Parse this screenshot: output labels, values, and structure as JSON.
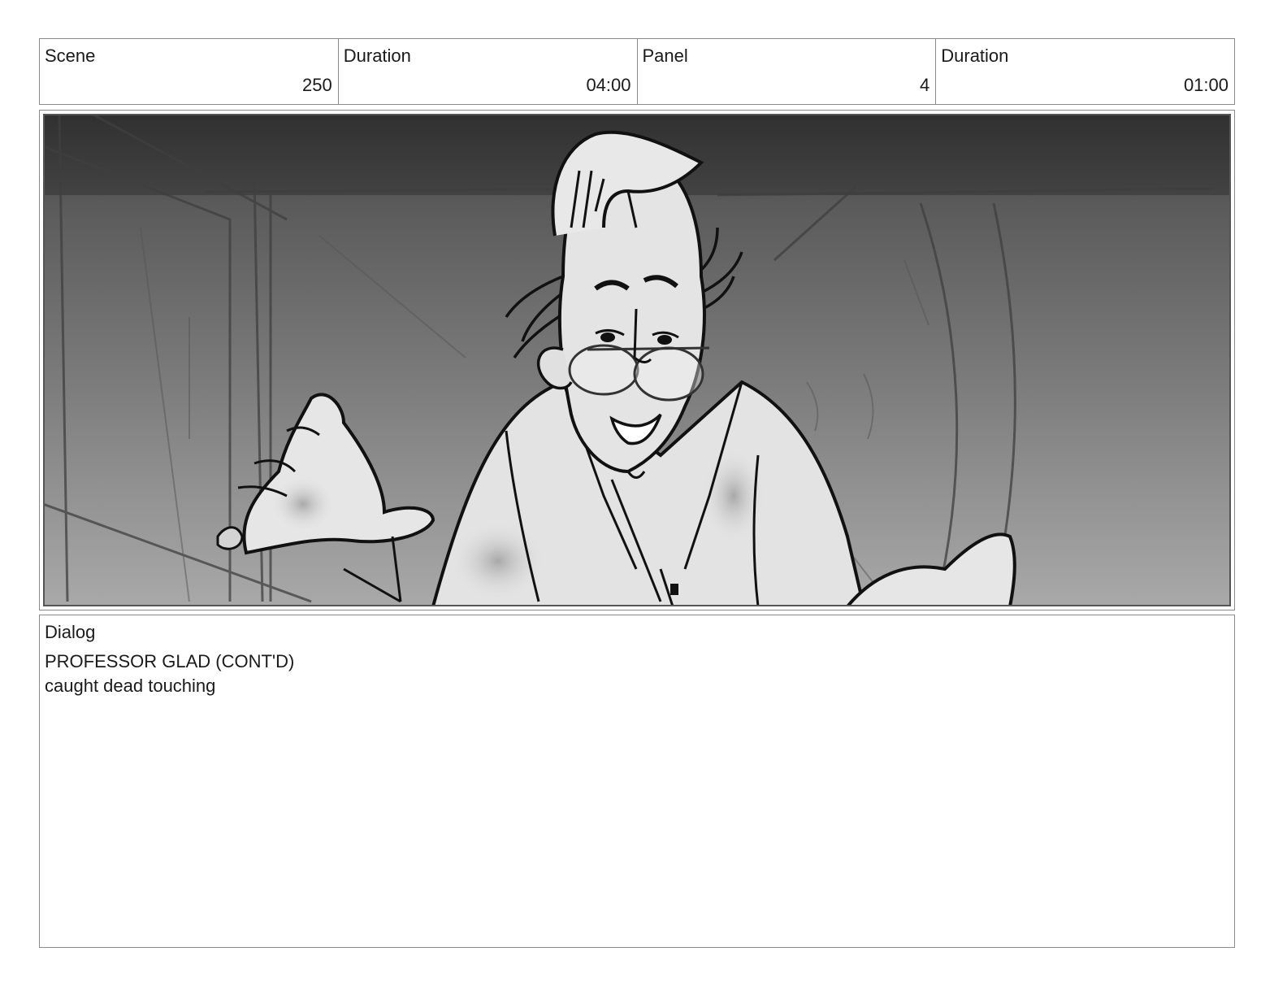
{
  "header": {
    "scene_label": "Scene",
    "scene_value": "250",
    "scene_duration_label": "Duration",
    "scene_duration_value": "04:00",
    "panel_label": "Panel",
    "panel_value": "4",
    "panel_duration_label": "Duration",
    "panel_duration_value": "01:00"
  },
  "dialog": {
    "label": "Dialog",
    "lines": [
      "PROFESSOR GLAD (CONT'D)",
      "caught dead touching"
    ]
  }
}
